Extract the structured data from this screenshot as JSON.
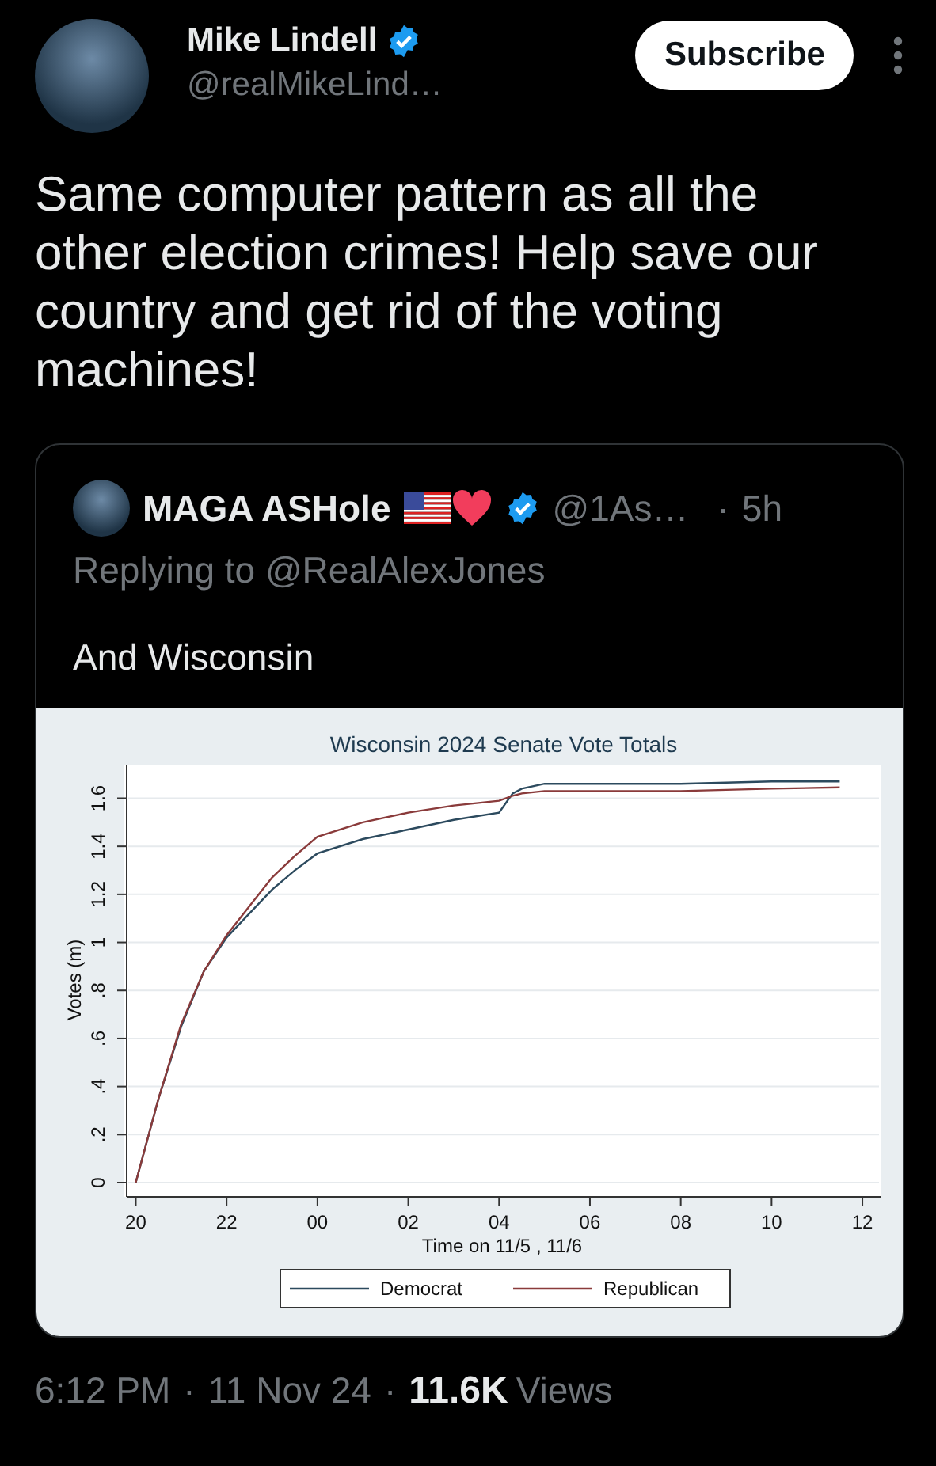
{
  "tweet": {
    "author": {
      "name": "Mike Lindell",
      "handle": "@realMikeLind…",
      "verified": true
    },
    "subscribe_button": "Subscribe",
    "text": "Same computer pattern as all the other election crimes! Help save our country and get rid of the voting machines!",
    "quote": {
      "author": {
        "name": "MAGA ASHole",
        "handle": "@1As…",
        "verified": true
      },
      "separator": "·",
      "age": "5h",
      "replying_to": "Replying to @RealAlexJones",
      "text": "And Wisconsin",
      "chart_data": {
        "type": "line",
        "title": "Wisconsin 2024 Senate Vote Totals",
        "xlabel": "Time on 11/5 , 11/6",
        "ylabel": "Votes (m)",
        "x": [
          "2024-11-05T20:00",
          "2024-11-05T20:30",
          "2024-11-05T21:00",
          "2024-11-05T21:30",
          "2024-11-05T22:00",
          "2024-11-05T22:30",
          "2024-11-05T23:00",
          "2024-11-05T23:30",
          "2024-11-06T00:00",
          "2024-11-06T01:00",
          "2024-11-06T02:00",
          "2024-11-06T03:00",
          "2024-11-06T04:00",
          "2024-11-06T04:18",
          "2024-11-06T04:30",
          "2024-11-06T05:00",
          "2024-11-06T06:00",
          "2024-11-06T08:00",
          "2024-11-06T10:00",
          "2024-11-06T11:30"
        ],
        "series": [
          {
            "name": "Democrat",
            "color": "#2c4a5e",
            "values": [
              0,
              0.35,
              0.65,
              0.88,
              1.02,
              1.12,
              1.22,
              1.3,
              1.37,
              1.43,
              1.47,
              1.51,
              1.54,
              1.62,
              1.64,
              1.66,
              1.66,
              1.66,
              1.67,
              1.67
            ]
          },
          {
            "name": "Republican",
            "color": "#8a3b3b",
            "values": [
              0,
              0.35,
              0.66,
              0.88,
              1.03,
              1.15,
              1.27,
              1.36,
              1.44,
              1.5,
              1.54,
              1.57,
              1.59,
              1.61,
              1.62,
              1.63,
              1.63,
              1.63,
              1.64,
              1.645
            ]
          }
        ],
        "xlim": [
          "2024-11-05T19:48",
          "2024-11-06T12:24"
        ],
        "ylim": [
          0,
          1.74
        ],
        "grid": true,
        "legend": true,
        "xticks": [
          {
            "value": "2024-11-05T20:00",
            "label": "20"
          },
          {
            "value": "2024-11-05T22:00",
            "label": "22"
          },
          {
            "value": "2024-11-06T00:00",
            "label": "00"
          },
          {
            "value": "2024-11-06T02:00",
            "label": "02"
          },
          {
            "value": "2024-11-06T04:00",
            "label": "04"
          },
          {
            "value": "2024-11-06T06:00",
            "label": "06"
          },
          {
            "value": "2024-11-06T08:00",
            "label": "08"
          },
          {
            "value": "2024-11-06T10:00",
            "label": "10"
          },
          {
            "value": "2024-11-06T12:00",
            "label": "12"
          }
        ],
        "yticks": [
          {
            "value": 0,
            "label": "0"
          },
          {
            "value": 0.2,
            "label": ".2"
          },
          {
            "value": 0.4,
            "label": ".4"
          },
          {
            "value": 0.6,
            "label": ".6"
          },
          {
            "value": 0.8,
            "label": ".8"
          },
          {
            "value": 1,
            "label": "1"
          },
          {
            "value": 1.2,
            "label": "1.2"
          },
          {
            "value": 1.4,
            "label": "1.4"
          },
          {
            "value": 1.6,
            "label": "1.6"
          }
        ]
      }
    },
    "footer": {
      "time": "6:12 PM",
      "separator": "·",
      "date": "11 Nov 24",
      "views_count": "11.6K",
      "views_label": "Views"
    }
  }
}
